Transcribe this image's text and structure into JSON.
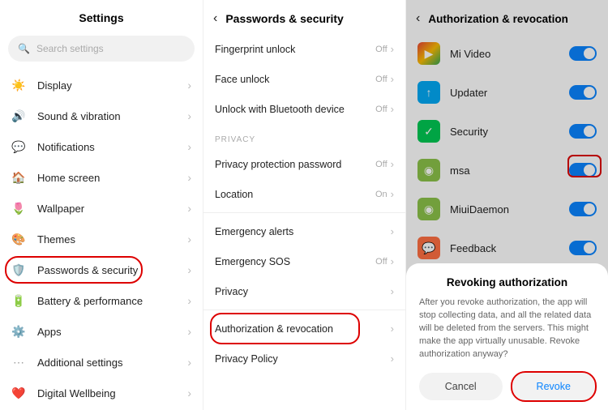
{
  "panel1": {
    "title": "Settings",
    "search_placeholder": "Search settings",
    "items": [
      {
        "icon": "☀️",
        "label": "Display"
      },
      {
        "icon": "🔊",
        "label": "Sound & vibration",
        "icon_color": "#4caf50"
      },
      {
        "icon": "💬",
        "label": "Notifications",
        "icon_color": "#2196f3"
      },
      {
        "icon": "🏠",
        "label": "Home screen",
        "icon_color": "#9c27b0"
      },
      {
        "icon": "🌷",
        "label": "Wallpaper",
        "icon_color": "#e91e63"
      },
      {
        "icon": "🎨",
        "label": "Themes",
        "icon_color": "#2196f3"
      },
      {
        "icon": "🛡️",
        "label": "Passwords & security",
        "highlight": true,
        "icon_color": "#673ab7"
      },
      {
        "icon": "🔋",
        "label": "Battery & performance",
        "icon_color": "#4caf50"
      },
      {
        "icon": "⚙️",
        "label": "Apps",
        "icon_color": "#2196f3"
      },
      {
        "icon": "⋯",
        "label": "Additional settings",
        "icon_color": "#9e9e9e"
      },
      {
        "icon": "❤️",
        "label": "Digital Wellbeing"
      }
    ]
  },
  "panel2": {
    "title": "Passwords & security",
    "group1": [
      {
        "label": "Fingerprint unlock",
        "value": "Off"
      },
      {
        "label": "Face unlock",
        "value": "Off"
      },
      {
        "label": "Unlock with Bluetooth device",
        "value": "Off"
      }
    ],
    "section_privacy": "PRIVACY",
    "group2": [
      {
        "label": "Privacy protection password",
        "value": "Off"
      },
      {
        "label": "Location",
        "value": "On"
      }
    ],
    "group3": [
      {
        "label": "Emergency alerts",
        "value": ""
      },
      {
        "label": "Emergency SOS",
        "value": "Off"
      },
      {
        "label": "Privacy",
        "value": ""
      }
    ],
    "group4": [
      {
        "label": "Authorization & revocation",
        "value": "",
        "highlight": true
      },
      {
        "label": "Privacy Policy",
        "value": ""
      }
    ]
  },
  "panel3": {
    "title": "Authorization & revocation",
    "apps": [
      {
        "label": "Mi Video",
        "color": "#fff",
        "icon": "▶",
        "icon_bg_style": "linear-gradient(135deg,#ea4335,#fbbc05 50%,#34a853)"
      },
      {
        "label": "Updater",
        "color": "#03a9f4",
        "icon": "↑"
      },
      {
        "label": "Security",
        "color": "#00c853",
        "icon": "✓"
      },
      {
        "label": "msa",
        "color": "#8bc34a",
        "icon": "◉",
        "highlight": true
      },
      {
        "label": "MiuiDaemon",
        "color": "#8bc34a",
        "icon": "◉"
      },
      {
        "label": "Feedback",
        "color": "#ff7043",
        "icon": "💬"
      }
    ],
    "dialog": {
      "title": "Revoking authorization",
      "body": "After you revoke authorization, the app will stop collecting data, and all the related data will be deleted from the servers. This might make the app virtually unusable. Revoke authorization anyway?",
      "cancel": "Cancel",
      "revoke": "Revoke"
    }
  }
}
